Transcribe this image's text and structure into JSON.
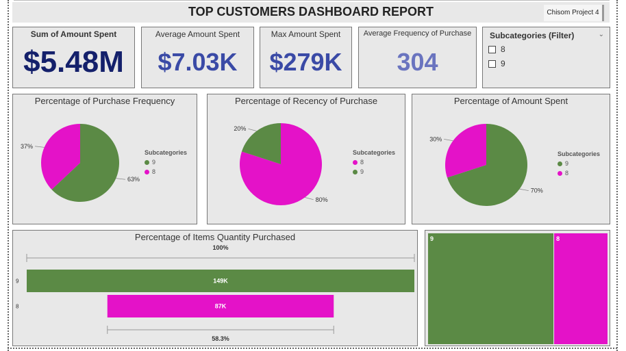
{
  "header": {
    "title": "TOP CUSTOMERS DASHBOARD REPORT",
    "project": "Chisom Project 4"
  },
  "kpis": [
    {
      "label": "Sum of Amount Spent",
      "value": "$5.48M"
    },
    {
      "label": "Average Amount Spent",
      "value": "$7.03K"
    },
    {
      "label": "Max Amount Spent",
      "value": "$279K"
    },
    {
      "label": "Average Frequency of Purchase",
      "value": "304"
    }
  ],
  "filter": {
    "title": "Subcategories (Filter)",
    "options": [
      "8",
      "9"
    ]
  },
  "colors": {
    "cat9": "#5b8a45",
    "cat8": "#e412c8",
    "kpi1": "#14206b",
    "kpi2": "#3a4aa6",
    "kpi3": "#3a4aa6",
    "kpi4": "#6a74bf"
  },
  "chart_data": [
    {
      "type": "pie",
      "title": "Percentage of Purchase Frequency",
      "legend_title": "Subcategories",
      "legend": [
        "9",
        "8"
      ],
      "slices": [
        {
          "name": "9",
          "value": 63,
          "label": "63%"
        },
        {
          "name": "8",
          "value": 37,
          "label": "37%"
        }
      ]
    },
    {
      "type": "pie",
      "title": "Percentage of Recency of Purchase",
      "legend_title": "Subcategories",
      "legend": [
        "8",
        "9"
      ],
      "slices": [
        {
          "name": "8",
          "value": 80,
          "label": "80%"
        },
        {
          "name": "9",
          "value": 20,
          "label": "20%"
        }
      ]
    },
    {
      "type": "pie",
      "title": "Percentage of Amount Spent",
      "legend_title": "Subcategories",
      "legend": [
        "9",
        "8"
      ],
      "slices": [
        {
          "name": "9",
          "value": 70,
          "label": "70%"
        },
        {
          "name": "8",
          "value": 30,
          "label": "30%"
        }
      ]
    },
    {
      "type": "bar",
      "title": "Percentage of Items Quantity Purchased",
      "categories": [
        "9",
        "8"
      ],
      "values": [
        149,
        87
      ],
      "value_labels": [
        "149K",
        "87K"
      ],
      "top_label": "100%",
      "bottom_label": "58.3%"
    },
    {
      "type": "treemap",
      "categories": [
        "9",
        "8"
      ],
      "values": [
        70,
        30
      ]
    }
  ]
}
